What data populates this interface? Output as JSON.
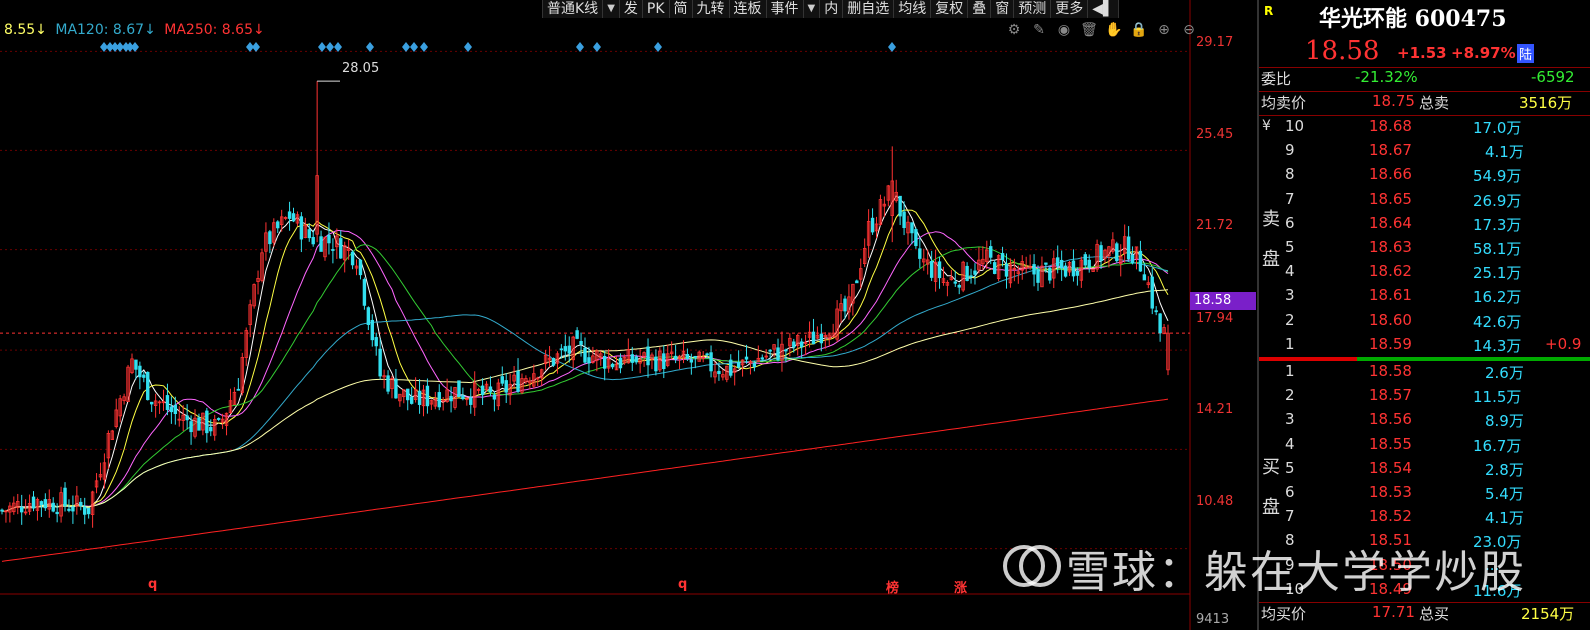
{
  "toolbar": [
    {
      "label": "普通K线",
      "arrow": true
    },
    {
      "label": "发"
    },
    {
      "label": "PK"
    },
    {
      "label": "简"
    },
    {
      "label": "九转"
    },
    {
      "label": "连板"
    },
    {
      "label": "事件",
      "arrow": true
    },
    {
      "label": "内"
    },
    {
      "label": "删自选"
    },
    {
      "label": "均线"
    },
    {
      "label": "复权"
    },
    {
      "label": "叠"
    },
    {
      "label": "窗"
    },
    {
      "label": "预测"
    },
    {
      "label": "更多"
    },
    {
      "label": "◀▌"
    }
  ],
  "ma_legend": [
    {
      "text": "8.55↓",
      "color": "#ffff66"
    },
    {
      "text": "MA120: 8.67↓",
      "color": "#33aacc"
    },
    {
      "text": "MA250: 8.65↓",
      "color": "#ff3333"
    }
  ],
  "y_labels": [
    "29.17",
    "25.45",
    "21.72",
    "17.94",
    "14.21",
    "10.48",
    "9413"
  ],
  "current_price_label": "18.58",
  "annotations": {
    "high": "28.05",
    "markers": [
      "q",
      "q",
      "榜",
      "涨"
    ]
  },
  "colors": {
    "up": "#ff3333",
    "down": "#33e0f0",
    "ma5": "#ffffff",
    "ma10": "#ffff44",
    "ma20": "#ff66ff",
    "ma30": "#33cc33",
    "ma60": "#33aacc",
    "ma120": "#ffffaa",
    "ma250": "#ff2222",
    "diamond": "#3aa0e0"
  },
  "panel": {
    "flag": "R",
    "title": "华光环能 600475",
    "price": "18.58",
    "change": "+1.53",
    "change_pct": "+8.97%",
    "badge": "陆",
    "weibi_label": "委比",
    "weibi_value": "-21.32%",
    "weibi_diff": "-6592",
    "avg_sell_label": "均卖价",
    "avg_sell_value": "18.75",
    "total_sell_label": "总卖",
    "total_sell_value": "3516万",
    "sell_side_label": "卖盘",
    "buy_side_label": "买盘",
    "currency": "¥",
    "sell": [
      {
        "level": "10",
        "price": "18.68",
        "vol": "17.0万"
      },
      {
        "level": "9",
        "price": "18.67",
        "vol": "4.1万"
      },
      {
        "level": "8",
        "price": "18.66",
        "vol": "54.9万"
      },
      {
        "level": "7",
        "price": "18.65",
        "vol": "26.9万"
      },
      {
        "level": "6",
        "price": "18.64",
        "vol": "17.3万"
      },
      {
        "level": "5",
        "price": "18.63",
        "vol": "58.1万"
      },
      {
        "level": "4",
        "price": "18.62",
        "vol": "25.1万"
      },
      {
        "level": "3",
        "price": "18.61",
        "vol": "16.2万"
      },
      {
        "level": "2",
        "price": "18.60",
        "vol": "42.6万"
      },
      {
        "level": "1",
        "price": "18.59",
        "vol": "14.3万",
        "extra": "+0.9"
      }
    ],
    "buy": [
      {
        "level": "1",
        "price": "18.58",
        "vol": "2.6万"
      },
      {
        "level": "2",
        "price": "18.57",
        "vol": "11.5万"
      },
      {
        "level": "3",
        "price": "18.56",
        "vol": "8.9万"
      },
      {
        "level": "4",
        "price": "18.55",
        "vol": "16.7万"
      },
      {
        "level": "5",
        "price": "18.54",
        "vol": "2.8万"
      },
      {
        "level": "6",
        "price": "18.53",
        "vol": "5.4万"
      },
      {
        "level": "7",
        "price": "18.52",
        "vol": "4.1万"
      },
      {
        "level": "8",
        "price": "18.51",
        "vol": "23.0万"
      },
      {
        "level": "9",
        "price": "18.50",
        "vol": "..."
      },
      {
        "level": "10",
        "price": "18.49",
        "vol": "11.6万"
      }
    ],
    "avg_buy_label": "均买价",
    "avg_buy_value": "17.71",
    "total_buy_label": "总买",
    "total_buy_value": "2154万"
  },
  "watermark": "雪球：躲在大学学炒股",
  "chart_data": {
    "type": "candlestick",
    "title": "",
    "ylim": [
      9.0,
      30.5
    ],
    "y_ticks": [
      29.17,
      25.45,
      21.72,
      17.94,
      14.21,
      10.48
    ],
    "current_price": 18.58,
    "high_annotation": 28.05,
    "ma250_range": [
      10.0,
      16.1
    ]
  }
}
